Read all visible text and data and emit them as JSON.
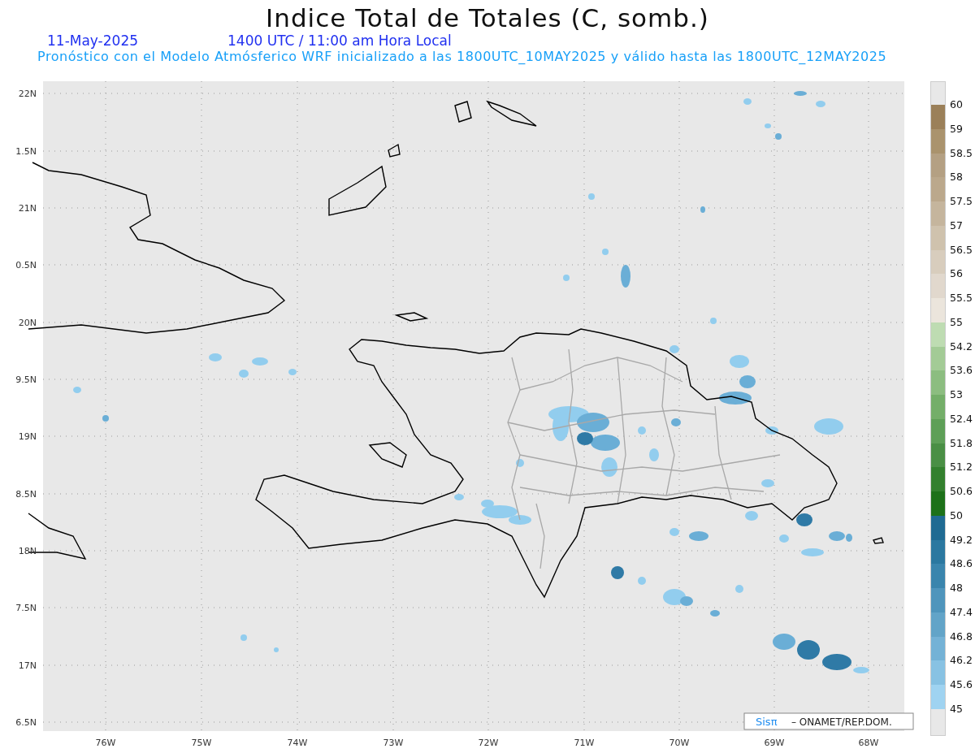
{
  "title": "Indice Total de Totales (C, somb.)",
  "date": "11-May-2025",
  "time": "1400 UTC / 11:00 am Hora Local",
  "subtitle": "Pronóstico con el Modelo Atmósferico WRF inicializado a las 1800UTC_10MAY2025 y válido hasta las  1800UTC_12MAY2025",
  "map": {
    "y_labels": [
      "22N",
      "1.5N",
      "21N",
      "0.5N",
      "20N",
      "9.5N",
      "19N",
      "8.5N",
      "18N",
      "7.5N",
      "17N",
      "6.5N"
    ],
    "x_labels": [
      "76W",
      "75W",
      "74W",
      "73W",
      "72W",
      "71W",
      "70W",
      "69W",
      "68W"
    ],
    "credit": {
      "logo": "Sisπ",
      "text": "– ONAMET/REP.DOM."
    }
  },
  "colorbar": {
    "bands": [
      {
        "label": "60",
        "color": "#9b8059"
      },
      {
        "label": "59",
        "color": "#aa936d"
      },
      {
        "label": "58.5",
        "color": "#b4a083"
      },
      {
        "label": "58",
        "color": "#bba88c"
      },
      {
        "label": "57.5",
        "color": "#c5b59d"
      },
      {
        "label": "57",
        "color": "#cfc2ad"
      },
      {
        "label": "56.5",
        "color": "#d8cdbd"
      },
      {
        "label": "56",
        "color": "#e1d8cd"
      },
      {
        "label": "55.5",
        "color": "#ebe5dc"
      },
      {
        "label": "55",
        "color": "#bedcb2"
      },
      {
        "label": "54.2",
        "color": "#a3cb96"
      },
      {
        "label": "53.6",
        "color": "#8cbd80"
      },
      {
        "label": "53",
        "color": "#74ae69"
      },
      {
        "label": "52.4",
        "color": "#5e9f57"
      },
      {
        "label": "51.8",
        "color": "#4a8f45"
      },
      {
        "label": "51.2",
        "color": "#33802e"
      },
      {
        "label": "50.6",
        "color": "#1d7119"
      },
      {
        "label": "50",
        "color": "#1f6a92"
      },
      {
        "label": "49.2",
        "color": "#2b78a0"
      },
      {
        "label": "48.6",
        "color": "#3a85ad"
      },
      {
        "label": "48",
        "color": "#4f95bc"
      },
      {
        "label": "47.4",
        "color": "#62a4c8"
      },
      {
        "label": "46.8",
        "color": "#74b2d6"
      },
      {
        "label": "46.2",
        "color": "#88c2e3"
      },
      {
        "label": "45.6",
        "color": "#9fd3f1"
      }
    ],
    "last_label": "45"
  }
}
